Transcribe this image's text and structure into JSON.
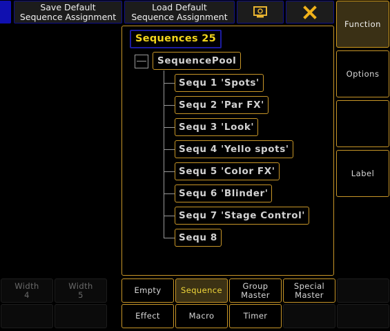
{
  "toolbar": {
    "save_line1": "Save Default",
    "save_line2": "Sequence Assignment",
    "load_line1": "Load Default",
    "load_line2": "Sequence Assignment",
    "icon_snapshot": "monitor-icon",
    "icon_close": "close-icon"
  },
  "side": {
    "function": "Function",
    "options": "Options",
    "label": "Label"
  },
  "tree": {
    "title": "Sequences 25",
    "pool": "SequencePool",
    "items": [
      "Sequ 1 'Spots'",
      "Sequ 2 'Par FX'",
      "Sequ 3 'Look'",
      "Sequ 4 'Yello spots'",
      "Sequ 5 'Color FX'",
      "Sequ 6 'Blinder'",
      "Sequ 7 'Stage Control'",
      "Sequ 8"
    ]
  },
  "bottom": {
    "width4_line1": "Width",
    "width4_line2": "4",
    "width5_line1": "Width",
    "width5_line2": "5",
    "empty": "Empty",
    "sequence": "Sequence",
    "group_line1": "Group",
    "group_line2": "Master",
    "special_line1": "Special",
    "special_line2": "Master",
    "effect": "Effect",
    "macro": "Macro",
    "timer": "Timer"
  },
  "colors": {
    "accent_gold": "#c89628",
    "title_yellow": "#f2d51c",
    "toolbar_blue": "#10108a",
    "active_fill": "#3a3015"
  }
}
